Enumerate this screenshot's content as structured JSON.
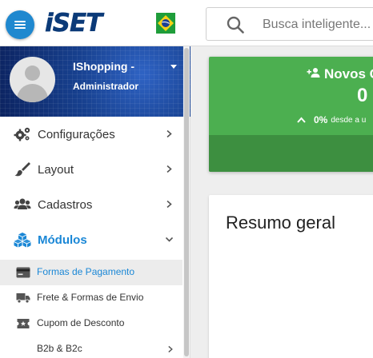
{
  "header": {
    "menu_icon": "hamburger-menu-icon",
    "brand": "iSET",
    "flag_icon": "brazil-flag-icon",
    "search": {
      "placeholder": "Busca inteligente...",
      "icon": "search-icon"
    }
  },
  "sidebar": {
    "profile": {
      "name": "IShopping -",
      "role": "Administrador"
    },
    "items": [
      {
        "label": "Configurações",
        "icon": "gears-icon"
      },
      {
        "label": "Layout",
        "icon": "paintbrush-icon"
      },
      {
        "label": "Cadastros",
        "icon": "users-icon"
      },
      {
        "label": "Módulos",
        "icon": "cubes-icon",
        "active": true,
        "expanded": true
      }
    ],
    "submenu": [
      {
        "label": "Formas de Pagamento",
        "icon": "credit-card-icon",
        "selected": true
      },
      {
        "label": "Frete & Formas de Envio",
        "icon": "truck-icon"
      },
      {
        "label": "Cupom de Desconto",
        "icon": "ticket-icon"
      },
      {
        "label": "B2b & B2c",
        "icon": ""
      }
    ]
  },
  "main": {
    "stat_card": {
      "title": "Novos C",
      "value": "0",
      "trend_percent": "0%",
      "trend_text": "desde a u",
      "icon": "user-plus-icon",
      "trend_icon": "chevron-up-icon",
      "color": "#4caf50"
    },
    "summary": {
      "title": "Resumo geral"
    }
  },
  "colors": {
    "accent": "#1a87d6",
    "sidebar_bg": "#ffffff",
    "header_blue": "#1f88cf"
  }
}
